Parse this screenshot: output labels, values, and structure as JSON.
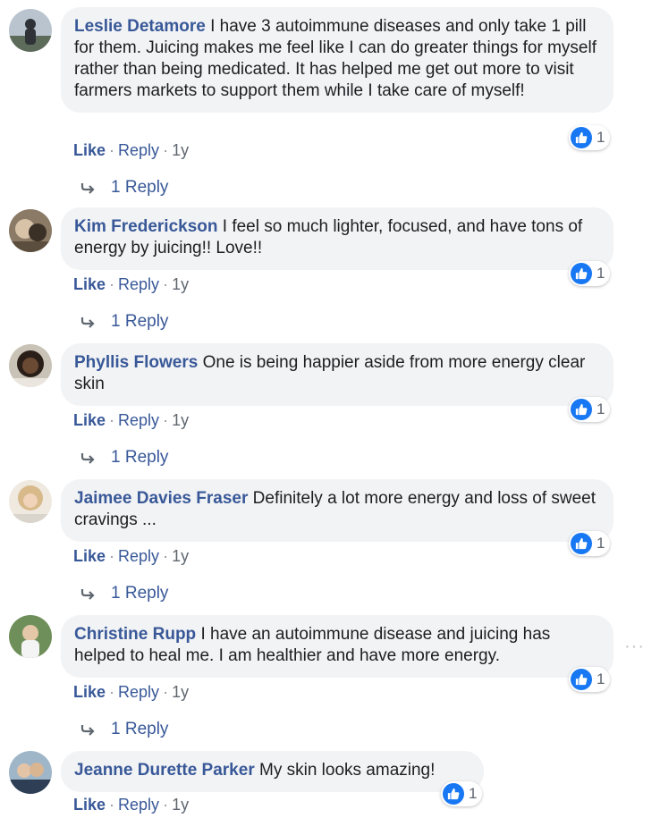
{
  "comments": [
    {
      "author": "Leslie Detamore",
      "text": "I have 3 autoimmune diseases and only take 1 pill for them. Juicing makes me feel like I can do greater things for myself rather than being medicated. It has helped me get out more to visit farmers markets to support them while I take care of myself!",
      "reaction_count": "1",
      "like": "Like",
      "reply": "Reply",
      "time": "1y",
      "replies": "1 Reply"
    },
    {
      "author": "Kim Frederickson",
      "text": "I feel so much lighter, focused, and have tons of energy by juicing!! Love!!",
      "reaction_count": "1",
      "like": "Like",
      "reply": "Reply",
      "time": "1y",
      "replies": "1 Reply"
    },
    {
      "author": "Phyllis Flowers",
      "text": "One is being happier aside from more energy clear skin",
      "reaction_count": "1",
      "like": "Like",
      "reply": "Reply",
      "time": "1y",
      "replies": "1 Reply"
    },
    {
      "author": "Jaimee Davies Fraser",
      "text": "Definitely a lot more energy and loss of sweet cravings ...",
      "reaction_count": "1",
      "like": "Like",
      "reply": "Reply",
      "time": "1y",
      "replies": "1 Reply"
    },
    {
      "author": "Christine Rupp",
      "text": "I have an autoimmune disease and juicing has helped to heal me. I am healthier and have more energy.",
      "reaction_count": "1",
      "like": "Like",
      "reply": "Reply",
      "time": "1y",
      "replies": "1 Reply"
    },
    {
      "author": "Jeanne Durette Parker",
      "text": "My skin looks amazing!",
      "reaction_count": "1",
      "like": "Like",
      "reply": "Reply",
      "time": "1y"
    }
  ],
  "options_icon": "more-options-icon",
  "colors": {
    "link": "#385898",
    "bubble": "#f2f3f5",
    "like_blue": "#1877f2",
    "meta": "#606770"
  }
}
